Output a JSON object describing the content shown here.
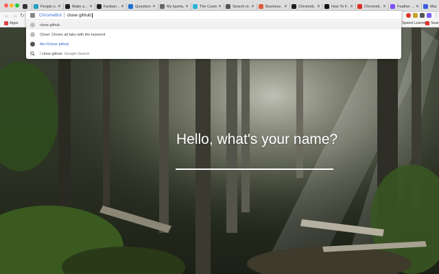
{
  "tabs": [
    {
      "title": "People o...",
      "color": "#24a0c4",
      "glyph": ""
    },
    {
      "title": "Make a ...",
      "color": "#1b1f23",
      "glyph": "github-icon"
    },
    {
      "title": "Kanban ...",
      "color": "#222222",
      "glyph": ""
    },
    {
      "title": "Questions",
      "color": "#1f6ed4",
      "glyph": ""
    },
    {
      "title": "My typefa...",
      "color": "#666666",
      "glyph": ""
    },
    {
      "title": "The Custo...",
      "color": "#2ab4d8",
      "glyph": ""
    },
    {
      "title": "Search re...",
      "color": "#555555",
      "glyph": ""
    },
    {
      "title": "Business ...",
      "color": "#e05b3a",
      "glyph": ""
    },
    {
      "title": "Chromeb...",
      "color": "#1b1f23",
      "glyph": "github-icon"
    },
    {
      "title": "How To F...",
      "color": "#111111",
      "glyph": ""
    },
    {
      "title": "Chromeb...",
      "color": "#d93025",
      "glyph": ""
    },
    {
      "title": "Feather ...",
      "color": "#7c4dff",
      "glyph": ""
    },
    {
      "title": "Mar...",
      "color": "#3b5bdb",
      "glyph": ""
    }
  ],
  "omnibox": {
    "keyword": "ChromeBot",
    "typed": "close github"
  },
  "suggestions": [
    {
      "text": "close github",
      "suffix": "",
      "icon": "keyword-icon",
      "kind": "plain"
    },
    {
      "text": "Close: Closes all tabs with the keyword",
      "suffix": "",
      "icon": "keyword-icon",
      "kind": "plain"
    },
    {
      "text": "file:///close github",
      "suffix": "",
      "icon": "globe-icon",
      "kind": "url"
    },
    {
      "text": "/ close github",
      "suffix": " - Google Search",
      "icon": "search-icon",
      "kind": "search"
    }
  ],
  "bookmarks": {
    "apps": "Apps",
    "right1": "Speed Learning",
    "right2": "Sear"
  },
  "main": {
    "prompt": "Hello, what's your name?",
    "name_value": ""
  },
  "colors": {
    "accent_link": "#3366cc",
    "keyword_blue": "#3a6fd8",
    "prompt_text": "#ffffff"
  }
}
